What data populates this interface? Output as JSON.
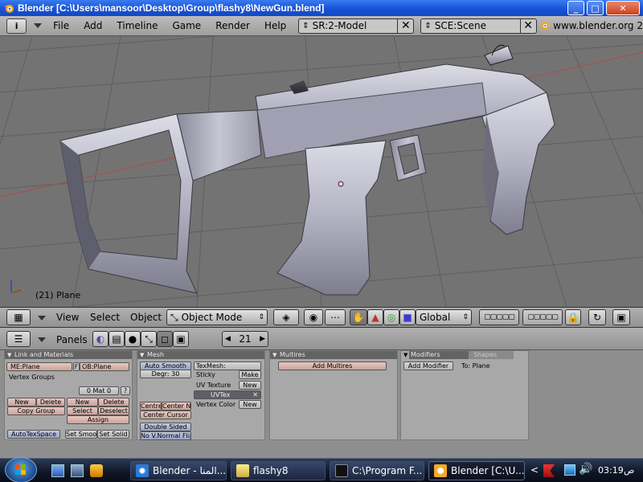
{
  "window": {
    "title": "Blender [C:\\Users\\mansoor\\Desktop\\Group\\flashy8\\NewGun.blend]",
    "minimize_glyph": "_",
    "maximize_glyph": "□",
    "close_glyph": "✕"
  },
  "menubar": {
    "info_glyph": "i",
    "menus": [
      "File",
      "Add",
      "Timeline",
      "Game",
      "Render",
      "Help"
    ],
    "screen_field": "SR:2-Model",
    "scene_field": "SCE:Scene",
    "clear_glyph": "✕",
    "website": "www.blender.org 2"
  },
  "viewport": {
    "status": "(21) Plane",
    "background_color": "#737373",
    "gun_color": "#b4b4c4"
  },
  "view3d_header": {
    "menus": [
      "View",
      "Select",
      "Object"
    ],
    "mode": "Object Mode",
    "orientation": "Global"
  },
  "buttons_window": {
    "panels_label": "Panels",
    "frame_number": "21",
    "link_materials": {
      "title": "Link and Materials",
      "mesh_name": "ME:Plane",
      "f_label": "F",
      "object_name": "OB:Plane",
      "vertex_groups": "Vertex Groups",
      "mat_counter": "0 Mat 0",
      "mat_help": "?",
      "new": "New",
      "delete": "Delete",
      "copy_group": "Copy Group",
      "new2": "New",
      "delete2": "Delete",
      "select": "Select",
      "deselect": "Deselect",
      "assign": "Assign",
      "autotexspace": "AutoTexSpace",
      "set_smooth": "Set Smoo",
      "set_solid": "Set Solid"
    },
    "mesh": {
      "title": "Mesh",
      "auto_smooth": "Auto Smooth",
      "degree": "Degr: 30",
      "center_new": "Centre",
      "center_new2": "Center Ne",
      "center_cursor": "Center Cursor",
      "double_sided": "Double Sided",
      "no_vnormal_flip": "No V.Normal Flip",
      "texmesh": "TexMesh:",
      "sticky": "Sticky",
      "make": "Make",
      "uv_texture": "UV Texture",
      "uv_new": "New",
      "uvtex": "UVTex",
      "vertex_color": "Vertex Color",
      "vc_new": "New"
    },
    "multires": {
      "title": "Multires",
      "add_multires": "Add Multires"
    },
    "modifiers": {
      "title": "Modifiers",
      "shapes_tab": "Shapes",
      "add_modifier": "Add Modifier",
      "to_plane": "To: Plane"
    }
  },
  "taskbar": {
    "tasks": [
      "Blender - المنا...",
      "flashy8",
      "C:\\Program F...",
      "Blender [C:\\U..."
    ],
    "tray_chevron": "<",
    "clock": "03:19",
    "am_pm": "ص"
  }
}
